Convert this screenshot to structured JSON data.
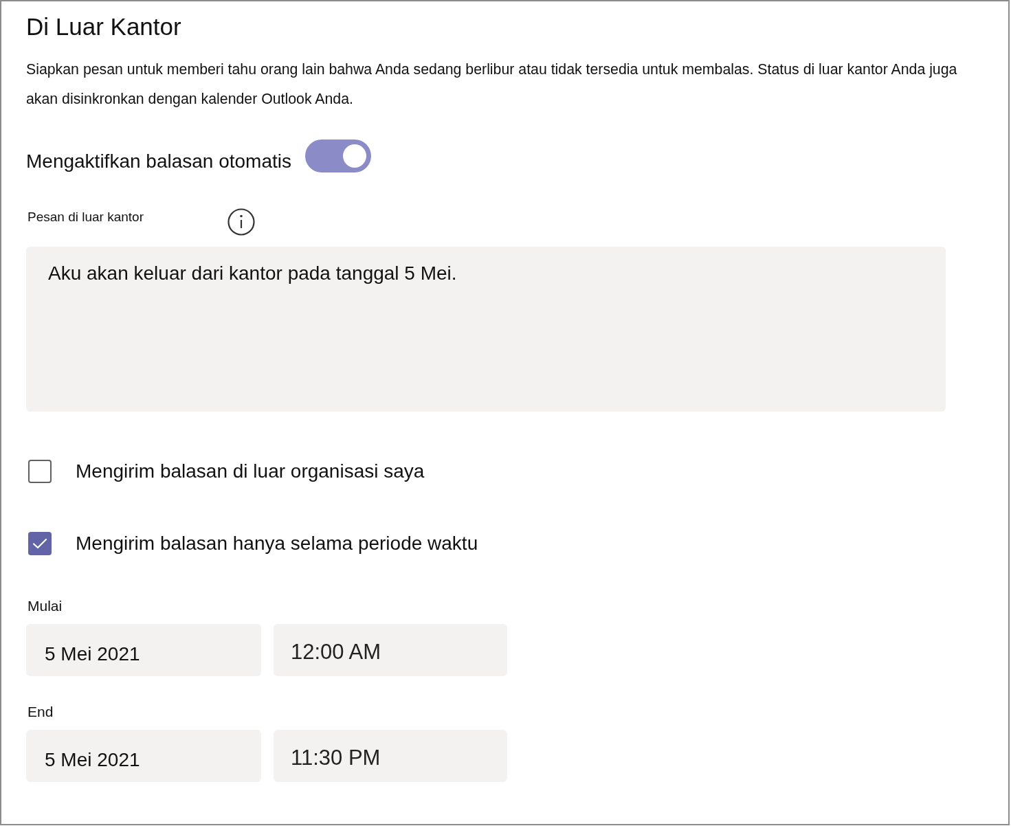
{
  "title": "Di Luar Kantor",
  "description": "Siapkan pesan untuk memberi tahu orang lain bahwa Anda sedang berlibur atau tidak tersedia untuk membalas. Status di luar kantor Anda juga akan disinkronkan dengan kalender Outlook Anda.",
  "auto_reply": {
    "label": "Mengaktifkan balasan otomatis",
    "on": true
  },
  "message": {
    "label": "Pesan di luar kantor",
    "value": "Aku akan keluar dari kantor pada tanggal 5 Mei."
  },
  "options": [
    {
      "label": "Mengirim balasan di luar organisasi saya",
      "checked": false
    },
    {
      "label": "Mengirim balasan hanya selama periode waktu",
      "checked": true
    }
  ],
  "schedule": [
    {
      "label": "Mulai",
      "date": "5 Mei 2021",
      "time": "12:00 AM"
    },
    {
      "label": "End",
      "date": "5 Mei 2021",
      "time": "11:30 PM"
    }
  ]
}
